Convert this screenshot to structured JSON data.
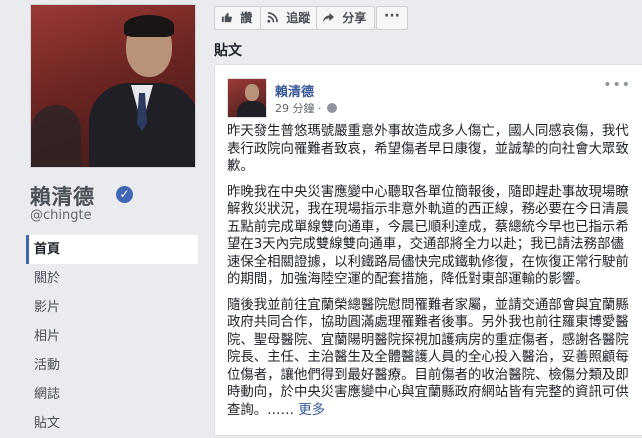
{
  "profile": {
    "name": "賴清德",
    "username": "@chingte",
    "verified_color": "#4267b2"
  },
  "left_nav": {
    "items": [
      {
        "label": "首頁",
        "active": true
      },
      {
        "label": "關於",
        "active": false
      },
      {
        "label": "影片",
        "active": false
      },
      {
        "label": "相片",
        "active": false
      },
      {
        "label": "活動",
        "active": false
      },
      {
        "label": "網誌",
        "active": false
      },
      {
        "label": "貼文",
        "active": false
      }
    ]
  },
  "actions": {
    "like_label": "讚",
    "like_icon": "thumbs-up-icon",
    "follow_label": "追蹤",
    "follow_icon": "rss-icon",
    "share_label": "分享",
    "share_icon": "share-arrow-icon",
    "more_label": "···"
  },
  "posts_heading": "貼文",
  "post": {
    "author": "賴清德",
    "time": "29 分鐘 ·",
    "paragraphs": [
      "昨天發生普悠瑪號嚴重意外事故造成多人傷亡，國人同感哀傷，我代表行政院向罹難者致哀，希望傷者早日康復，並誠摯的向社會大眾致歉。",
      "昨晚我在中央災害應變中心聽取各單位簡報後，隨即趕赴事故現場瞭解救災狀況，我在現場指示非意外軌道的西正線，務必要在今日清晨五點前完成單線雙向通車，今晨已順利達成，蔡總統今早也已指示希望在3天內完成雙線雙向通車，交通部將全力以赴；我已請法務部儘速保全相關證據，以利鐵路局儘快完成鐵軌修復，在恢復正常行駛前的期間，加強海陸空運的配套措施，降低對東部運輸的影響。",
      "隨後我並前往宜蘭榮總醫院慰問罹難者家屬，並請交通部會與宜蘭縣政府共同合作，協助圓滿處理罹難者後事。另外我也前往羅東博愛醫院、聖母醫院、宜蘭陽明醫院探視加護病房的重症傷者，感謝各醫院院長、主任、主治醫生及全體醫護人員的全心投入醫治，妥善照顧每位傷者，讓他們得到最好醫療。目前傷者的收治醫院、檢傷分類及即時動向，於中央災害應變中心與宜蘭縣政府網站皆有完整的資訊可供查詢。"
    ],
    "ellipsis": "……",
    "see_more": "更多"
  },
  "colors": {
    "link": "#385898",
    "background": "#e9ebee"
  }
}
